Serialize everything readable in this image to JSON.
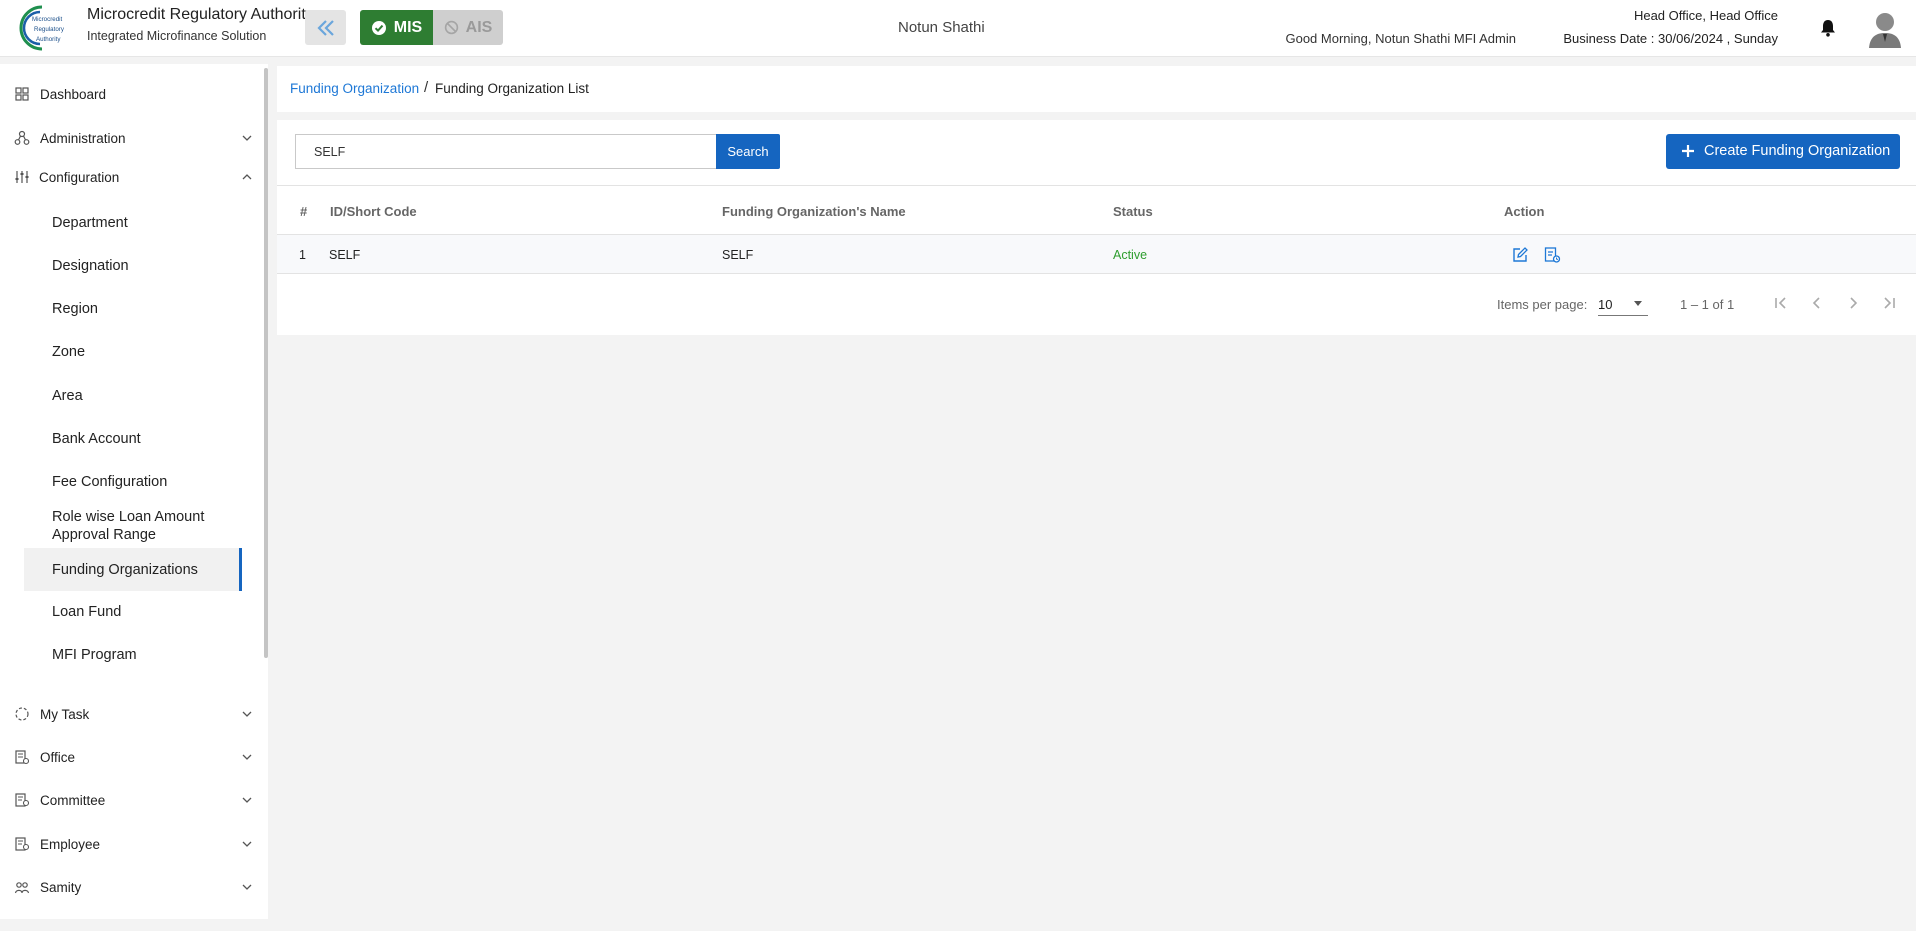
{
  "header": {
    "brand_title": "Microcredit Regulatory Authority",
    "brand_subtitle": "Integrated Microfinance Solution",
    "logo_text": "Microcredit Regulatory Authority",
    "mis_label": "MIS",
    "ais_label": "AIS",
    "org_name": "Notun Shathi",
    "greeting": "Good Morning, Notun Shathi MFI Admin",
    "office": "Head Office, Head Office",
    "business_date": "Business Date : 30/06/2024 , Sunday"
  },
  "sidebar": {
    "top_items": [
      {
        "label": "Dashboard",
        "icon": "grid-icon"
      },
      {
        "label": "Administration",
        "icon": "users-hierarchy-icon"
      },
      {
        "label": "Configuration",
        "icon": "sliders-icon"
      }
    ],
    "configuration_items": [
      {
        "label": "Department"
      },
      {
        "label": "Designation"
      },
      {
        "label": "Region"
      },
      {
        "label": "Zone"
      },
      {
        "label": "Area"
      },
      {
        "label": "Bank Account"
      },
      {
        "label": "Fee Configuration"
      },
      {
        "label": "Role wise Loan Amount Approval Range"
      },
      {
        "label": "Funding Organizations",
        "active": true
      },
      {
        "label": "Loan Fund"
      },
      {
        "label": "MFI Program"
      }
    ],
    "bottom_items": [
      {
        "label": "My Task",
        "icon": "task-circle-icon"
      },
      {
        "label": "Office",
        "icon": "office-icon"
      },
      {
        "label": "Committee",
        "icon": "committee-icon"
      },
      {
        "label": "Employee",
        "icon": "employee-icon"
      },
      {
        "label": "Samity",
        "icon": "samity-icon"
      }
    ]
  },
  "breadcrumb": {
    "parent": "Funding Organization",
    "separator": "/",
    "current": "Funding Organization List"
  },
  "search": {
    "value": "SELF",
    "button_label": "Search"
  },
  "create_button_label": "Create Funding Organization",
  "table": {
    "columns": [
      "#",
      "ID/Short Code",
      "Funding Organization's Name",
      "Status",
      "Action"
    ],
    "rows": [
      {
        "index": "1",
        "code": "SELF",
        "name": "SELF",
        "status": "Active"
      }
    ]
  },
  "pagination": {
    "items_per_page_label": "Items per page:",
    "items_per_page": "10",
    "range": "1 – 1 of 1"
  },
  "colors": {
    "primary": "#1565c0",
    "mis_green": "#2e7d32",
    "active_status": "#2e9d2e",
    "link": "#1e78d6"
  }
}
